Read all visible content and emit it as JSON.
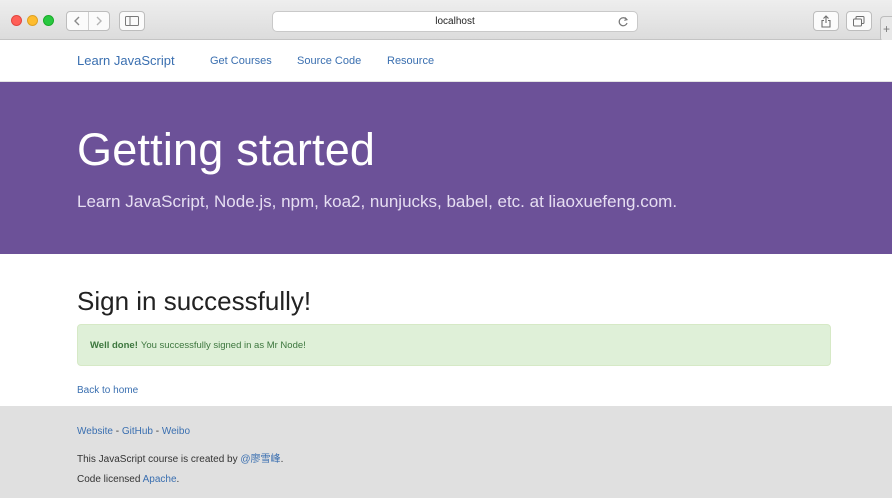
{
  "browser": {
    "url": "localhost"
  },
  "navbar": {
    "brand": "Learn JavaScript",
    "links": [
      "Get Courses",
      "Source Code",
      "Resource"
    ]
  },
  "jumbotron": {
    "title": "Getting started",
    "subtitle": "Learn JavaScript, Node.js, npm, koa2, nunjucks, babel, etc. at liaoxuefeng.com."
  },
  "content": {
    "title": "Sign in successfully!",
    "alert_strong": "Well done!",
    "alert_text": "You successfully signed in as Mr Node!",
    "back_link": "Back to home"
  },
  "footer": {
    "links": [
      "Website",
      "GitHub",
      "Weibo"
    ],
    "separator": " - ",
    "created_prefix": "This JavaScript course is created by ",
    "created_author": "@廖雪峰",
    "created_suffix": ".",
    "license_prefix": "Code licensed ",
    "license_link": "Apache",
    "license_suffix": "."
  }
}
